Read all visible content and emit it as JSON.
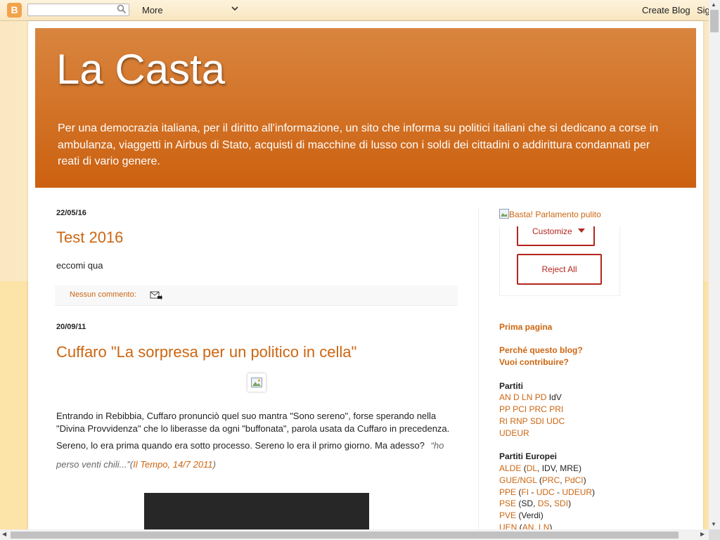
{
  "navbar": {
    "logo_glyph": "B",
    "search_placeholder": "",
    "more_label": "More",
    "more_chevron": "⌄",
    "create_blog": "Create Blog",
    "sign_in": "Sig"
  },
  "header": {
    "title": "La Casta",
    "description": "Per una democrazia italiana, per il diritto all'informazione, un sito che informa su politici italiani che si dedicano a corse in ambulanza, viaggetti in Airbus di Stato, acquisti di macchine di lusso con i soldi dei cittadini o addirittura condannati per reati di vario genere."
  },
  "posts": [
    {
      "date": "22/05/16",
      "title": "Test 2016",
      "body": "eccomi qua",
      "comments": "Nessun commento:"
    },
    {
      "date": "20/09/11",
      "title": "Cuffaro \"La sorpresa per un politico in cella\"",
      "line1": "Entrando in Rebibbia, Cuffaro pronunciò quel suo mantra \"Sono sereno\", forse sperando nella",
      "line2": " \"Divina Provvidenza\" che lo liberasse da ogni \"buffonata\", parola usata da Cuffaro in precedenza.",
      "line3": "Sereno, lo era prima quando era sotto processo. Sereno lo era il primo giorno. Ma adesso?",
      "quote_a": "“ho",
      "quote_b": "perso venti chili...”",
      "source_open": "(",
      "source_link": "Il Tempo, 14/7 2011",
      "source_close": ")"
    }
  ],
  "sidebar": {
    "banner_alt": "Basta! Parlamento pulito",
    "customize": "Customize",
    "reject_all": "Reject All",
    "prima_pagina": "Prima pagina",
    "perche": "Perché questo blog?",
    "contribuire": "Vuoi contribuire?",
    "partiti_heading": "Partiti",
    "partiti_row1": [
      "AN",
      "D",
      "LN",
      "PD"
    ],
    "partiti_row1_plain": "IdV",
    "partiti_row2": [
      "PP",
      "PCI",
      "PRC",
      "PRI"
    ],
    "partiti_row3": [
      "RI",
      "RNP",
      "SDI",
      "UDC"
    ],
    "partiti_row4": [
      "UDEUR"
    ],
    "europei_heading": "Partiti Europei",
    "alde": "ALDE",
    "dl": "DL",
    "alde_rest": ", IDV, MRE)",
    "gue": "GUE/NGL",
    "prc": "PRC",
    "pdci": "PdCI",
    "ppe": "PPE",
    "fi": "FI",
    "udc": "UDC",
    "udeur": "UDEUR",
    "pse": "PSE",
    "sd": "(SD, ",
    "ds": "DS",
    "sdi": "SDI",
    "pve": "PVE",
    "verdi": "(Verdi)",
    "uen": "UEN",
    "an": "AN",
    "ln": "LN"
  },
  "colors": {
    "accent": "#cc6611",
    "header_top": "#d9853f",
    "header_bottom": "#cc6110",
    "consent_red": "#b3261e"
  }
}
